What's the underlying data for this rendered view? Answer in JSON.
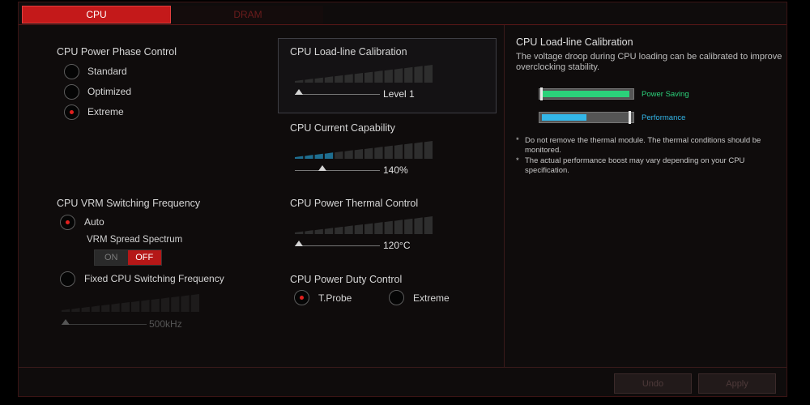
{
  "tabs": {
    "cpu": "CPU",
    "dram": "DRAM"
  },
  "phase_control": {
    "title": "CPU Power Phase Control",
    "options": [
      {
        "label": "Standard",
        "checked": false
      },
      {
        "label": "Optimized",
        "checked": false
      },
      {
        "label": "Extreme",
        "checked": true
      }
    ]
  },
  "vrm": {
    "title": "CPU VRM Switching Frequency",
    "auto_label": "Auto",
    "auto_checked": true,
    "spread_label": "VRM Spread Spectrum",
    "toggle_on": "ON",
    "toggle_off": "OFF",
    "fixed_label": "Fixed CPU Switching Frequency",
    "fixed_checked": false,
    "value": "500kHz",
    "level_fraction": 0
  },
  "llc": {
    "title": "CPU Load-line Calibration",
    "value": "Level 1",
    "level_fraction": 0
  },
  "current": {
    "title": "CPU Current Capability",
    "value": "140%",
    "level_fraction": 0.28
  },
  "thermal": {
    "title": "CPU Power Thermal Control",
    "value": "120°C",
    "level_fraction": 0
  },
  "duty": {
    "title": "CPU Power Duty Control",
    "options": [
      {
        "label": "T.Probe",
        "checked": true
      },
      {
        "label": "Extreme",
        "checked": false
      }
    ]
  },
  "help": {
    "title": "CPU Load-line Calibration",
    "description": "The voltage droop during CPU loading can be calibrated to improve overclocking stability.",
    "legend": [
      {
        "label": "Power Saving",
        "color": "#2bd17a",
        "fill_fraction": 0.98
      },
      {
        "label": "Performance",
        "color": "#33b6e8",
        "fill_fraction": 0.5
      }
    ],
    "notes": [
      "Do not remove the thermal module. The thermal conditions should be monitored.",
      "The actual performance boost may vary depending on your CPU specification."
    ]
  },
  "footer": {
    "undo": "Undo",
    "apply": "Apply"
  },
  "colors": {
    "accent": "#c4191a",
    "bar_active": "#1e6e90",
    "bar_idle": "#2e2e2e"
  }
}
